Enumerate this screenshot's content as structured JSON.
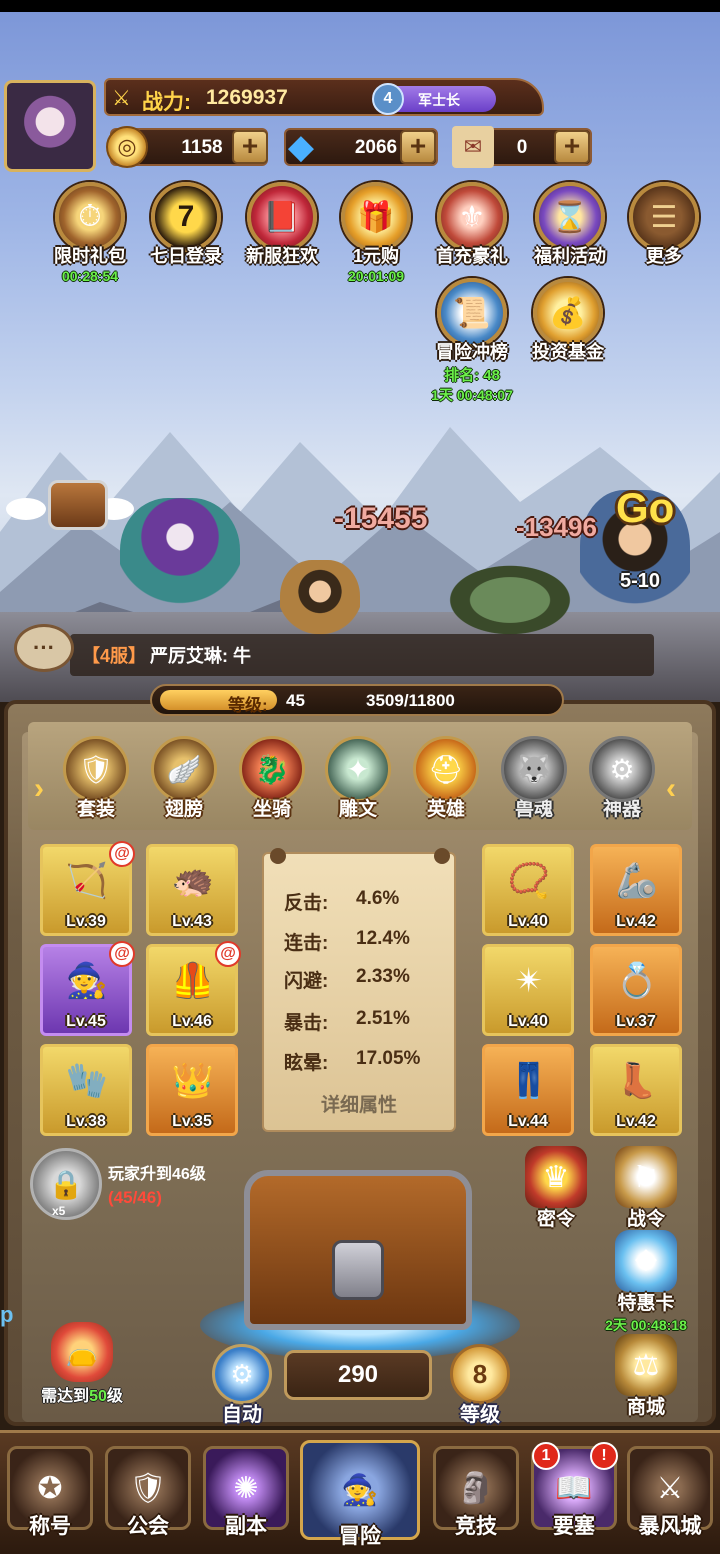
{
  "player": {
    "power_label": "战力:",
    "power_value": "1269937",
    "rank_level": "4",
    "rank_title": "军士长"
  },
  "currencies": [
    {
      "icon": "gold-coin-icon",
      "value": "1158"
    },
    {
      "icon": "diamond-icon",
      "value": "2066"
    },
    {
      "icon": "scroll-ticket-icon",
      "value": "0"
    }
  ],
  "activities": [
    {
      "label": "限时礼包",
      "timer": "00:28:54"
    },
    {
      "label": "七日登录",
      "timer": ""
    },
    {
      "label": "新服狂欢",
      "timer": ""
    },
    {
      "label": "1元购",
      "timer": "20:01:09"
    },
    {
      "label": "首充豪礼",
      "timer": ""
    },
    {
      "label": "福利活动",
      "timer": ""
    },
    {
      "label": "更多",
      "timer": ""
    }
  ],
  "activities_row2": [
    {
      "label": "冒险冲榜",
      "rank": "排名: 48",
      "timer": "1天 00:48:07"
    },
    {
      "label": "投资基金"
    }
  ],
  "battle": {
    "damage_1": "-15455",
    "damage_2": "-13496",
    "go_label": "Go",
    "stage": "5-10"
  },
  "chat": {
    "server": "【4服】",
    "message": "严厉艾琳: 牛"
  },
  "level_bar": {
    "label": "等级:",
    "level": "45",
    "exp": "3509/11800",
    "progress": 0.297
  },
  "tabs": [
    {
      "label": "套装",
      "icon": "armor-set-icon",
      "locked": false
    },
    {
      "label": "翅膀",
      "icon": "wings-icon",
      "locked": false
    },
    {
      "label": "坐骑",
      "icon": "dragon-mount-icon",
      "locked": false
    },
    {
      "label": "雕文",
      "icon": "glyph-icon",
      "locked": false
    },
    {
      "label": "英雄",
      "icon": "hero-helmet-icon",
      "locked": false
    },
    {
      "label": "兽魂",
      "icon": "beast-soul-icon",
      "locked": true
    },
    {
      "label": "神器",
      "icon": "artifact-icon",
      "locked": true
    }
  ],
  "equipment_left": [
    {
      "level": "Lv.39",
      "rarity": "gold",
      "badge": true,
      "icon": "bow-icon"
    },
    {
      "level": "Lv.43",
      "rarity": "gold",
      "badge": false,
      "icon": "shoulder-armor-icon"
    },
    {
      "level": "Lv.45",
      "rarity": "purple",
      "badge": true,
      "icon": "helmet-icon"
    },
    {
      "level": "Lv.46",
      "rarity": "gold",
      "badge": true,
      "icon": "chest-armor-icon"
    },
    {
      "level": "Lv.38",
      "rarity": "gold",
      "badge": false,
      "icon": "gloves-icon"
    },
    {
      "level": "Lv.35",
      "rarity": "orange",
      "badge": false,
      "icon": "belt-icon"
    }
  ],
  "equipment_right": [
    {
      "level": "Lv.40",
      "rarity": "gold",
      "icon": "necklace-icon"
    },
    {
      "level": "Lv.42",
      "rarity": "orange",
      "icon": "bracers-icon"
    },
    {
      "level": "Lv.40",
      "rarity": "gold",
      "icon": "amulet-icon"
    },
    {
      "level": "Lv.37",
      "rarity": "orange",
      "icon": "ring-icon"
    },
    {
      "level": "Lv.44",
      "rarity": "orange",
      "icon": "pants-icon"
    },
    {
      "level": "Lv.42",
      "rarity": "gold",
      "icon": "boots-icon"
    }
  ],
  "attributes": [
    {
      "name": "反击:",
      "value": "4.6%"
    },
    {
      "name": "连击:",
      "value": "12.4%"
    },
    {
      "name": "闪避:",
      "value": "2.33%"
    },
    {
      "name": "暴击:",
      "value": "2.51%"
    },
    {
      "name": "眩晕:",
      "value": "17.05%"
    }
  ],
  "attributes_more": "详细属性",
  "reward": {
    "text": "玩家升到46级",
    "progress": "(45/46)",
    "count": "x5"
  },
  "right_buttons": [
    {
      "label": "密令"
    },
    {
      "label": "战令"
    },
    {
      "label": "特惠卡",
      "timer": "2天 00:48:18"
    },
    {
      "label": "商城"
    }
  ],
  "controls": {
    "auto_label": "自动",
    "count": "290",
    "level_num": "8",
    "level_label": "等级",
    "need_prefix": "需达到",
    "need_level": "50",
    "need_suffix": "级"
  },
  "side_tag": "p",
  "nav": [
    {
      "label": "称号",
      "badge": ""
    },
    {
      "label": "公会",
      "badge": ""
    },
    {
      "label": "副本",
      "badge": ""
    },
    {
      "label": "冒险",
      "badge": ""
    },
    {
      "label": "竞技",
      "badge": ""
    },
    {
      "label": "要塞",
      "badge": "1",
      "badge2": "!"
    },
    {
      "label": "暴风城",
      "badge": ""
    }
  ],
  "colors": {
    "gold_text": "#ffd44a",
    "timer_green": "#6cf04a",
    "progress_red": "#ff4a3a",
    "chat_server": "#ff9a4a"
  }
}
